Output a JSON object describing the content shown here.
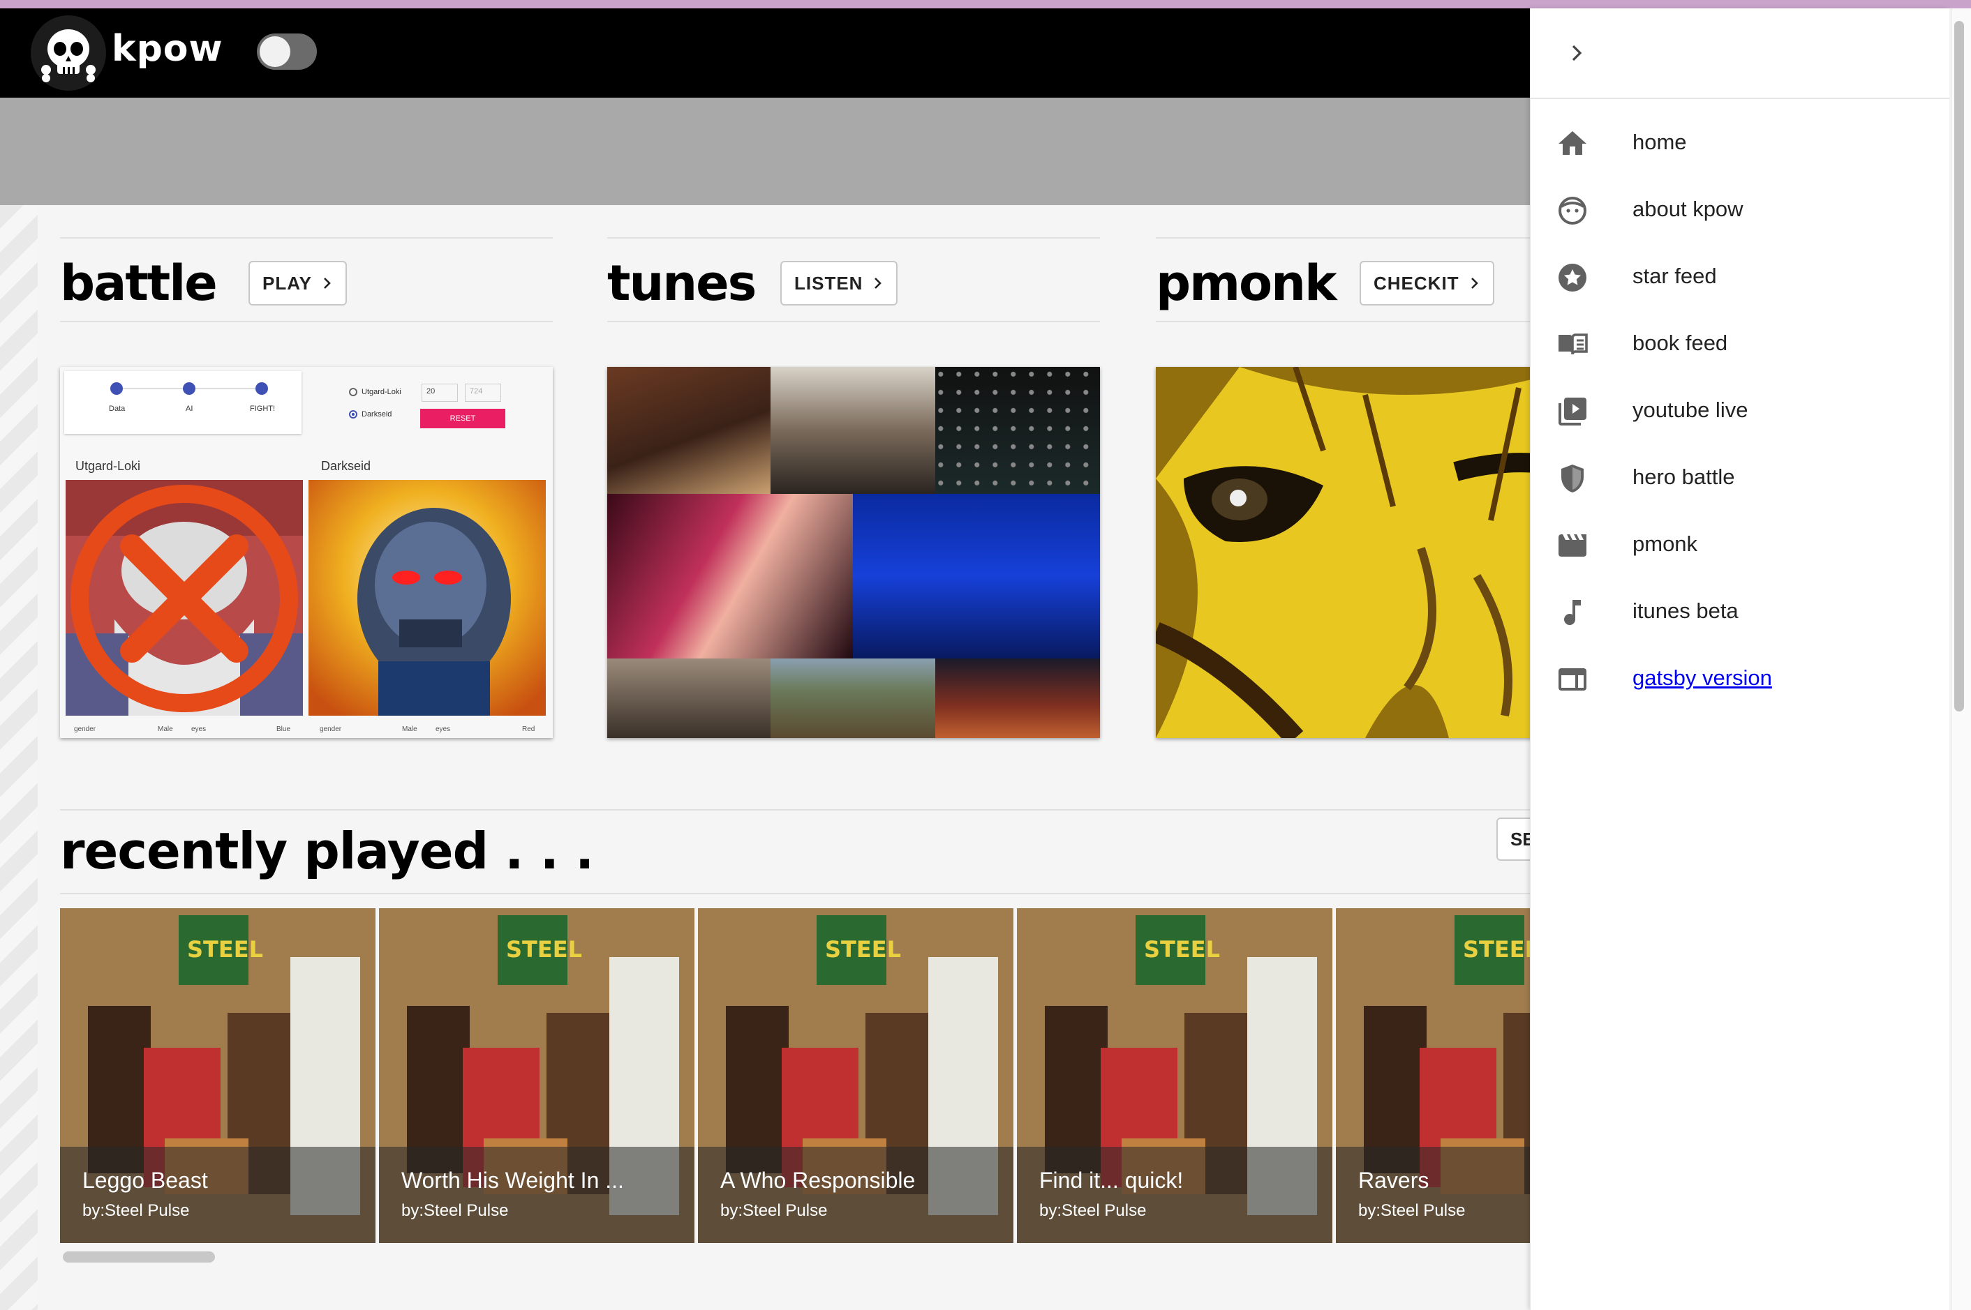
{
  "app": {
    "logo_text": "kpow"
  },
  "cards": [
    {
      "title": "battle",
      "button": "PLAY"
    },
    {
      "title": "tunes",
      "button": "LISTEN"
    },
    {
      "title": "pmonk",
      "button": "CHECKIT"
    }
  ],
  "battle_preview": {
    "steps": [
      "Data",
      "AI",
      "FIGHT!"
    ],
    "options": [
      "Utgard-Loki",
      "Darkseid"
    ],
    "bet_value": "20",
    "stash_value": "724",
    "reset_label": "RESET",
    "fighters": [
      "Utgard-Loki",
      "Darkseid"
    ],
    "stats_left": [
      "gender",
      "Male",
      "eyes",
      "Blue"
    ],
    "stats_right": [
      "gender",
      "Male",
      "eyes",
      "Red"
    ]
  },
  "recently_played": {
    "title": "recently played . . .",
    "see_button": "SE",
    "albums": [
      {
        "song": "Leggo Beast",
        "artist": "by:Steel Pulse"
      },
      {
        "song": "Worth His Weight In ...",
        "artist": "by:Steel Pulse"
      },
      {
        "song": "A Who Responsible",
        "artist": "by:Steel Pulse"
      },
      {
        "song": "Find it... quick!",
        "artist": "by:Steel Pulse"
      },
      {
        "song": "Ravers",
        "artist": "by:Steel Pulse"
      }
    ]
  },
  "drawer": {
    "items": [
      {
        "label": "home",
        "icon": "home-icon"
      },
      {
        "label": "about kpow",
        "icon": "face-icon"
      },
      {
        "label": "star feed",
        "icon": "star-icon"
      },
      {
        "label": "book feed",
        "icon": "book-icon"
      },
      {
        "label": "youtube live",
        "icon": "video-library-icon"
      },
      {
        "label": "hero battle",
        "icon": "shield-icon"
      },
      {
        "label": "pmonk",
        "icon": "film-icon"
      },
      {
        "label": "itunes beta",
        "icon": "music-note-icon"
      },
      {
        "label": "gatsby version",
        "icon": "web-icon"
      }
    ]
  },
  "colors": {
    "appbar": "#000000",
    "drawer_link": "#0000ee",
    "reset": "#e91e63"
  }
}
